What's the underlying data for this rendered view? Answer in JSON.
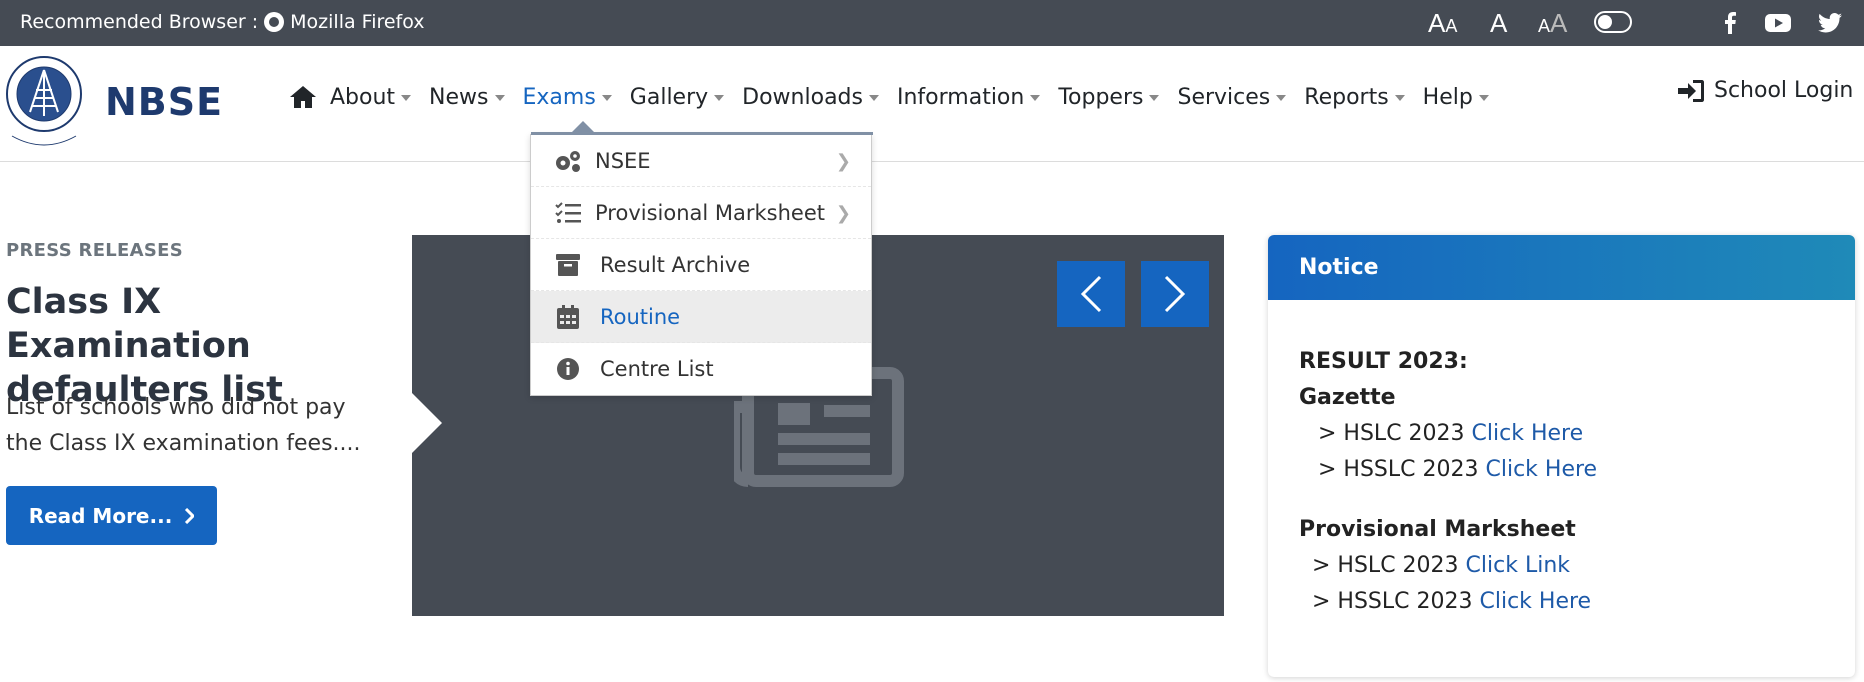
{
  "topbar": {
    "recommended_label": "Recommended Browser :",
    "browser_name": "Mozilla Firefox",
    "font_small": "A",
    "font_normal": "A",
    "font_large": "A"
  },
  "header": {
    "brand": "NBSE",
    "nav": {
      "about": "About",
      "news": "News",
      "exams": "Exams",
      "gallery": "Gallery",
      "downloads": "Downloads",
      "information": "Information",
      "toppers": "Toppers",
      "services": "Services",
      "reports": "Reports",
      "help": "Help"
    },
    "login": "School Login"
  },
  "dropdown": {
    "items": [
      {
        "label": "NSEE",
        "icon": "gears-icon",
        "has_submenu": true
      },
      {
        "label": "Provisional Marksheet",
        "icon": "tasks-icon",
        "has_submenu": true
      },
      {
        "label": "Result Archive",
        "icon": "archive-icon",
        "has_submenu": false
      },
      {
        "label": "Routine",
        "icon": "calendar-icon",
        "has_submenu": false,
        "highlighted": true
      },
      {
        "label": "Centre List",
        "icon": "info-circle-icon",
        "has_submenu": false
      }
    ]
  },
  "press": {
    "tag": "PRESS RELEASES",
    "title": "Class IX Examination defaulters list",
    "description": "List of schools who did not pay the Class IX examination fees....",
    "read_more": "Read More..."
  },
  "notice": {
    "title": "Notice",
    "result_heading": "RESULT 2023:",
    "gazette_heading": "Gazette",
    "gazette_hslc_prefix": "> HSLC 2023",
    "gazette_hslc_link": "Click Here",
    "gazette_hsslc_prefix": "> HSSLC 2023",
    "gazette_hsslc_link": "Click Here",
    "marksheet_heading": "Provisional Marksheet",
    "pm_hslc_prefix": "> HSLC 2023",
    "pm_hslc_link": "Click Link",
    "pm_hsslc_prefix": "> HSSLC 2023",
    "pm_hsslc_link": "Click Here"
  },
  "colors": {
    "topbar_bg": "#454b54",
    "accent": "#1565c0",
    "brand": "#1e3a6e",
    "slider_bg": "#454b54"
  }
}
